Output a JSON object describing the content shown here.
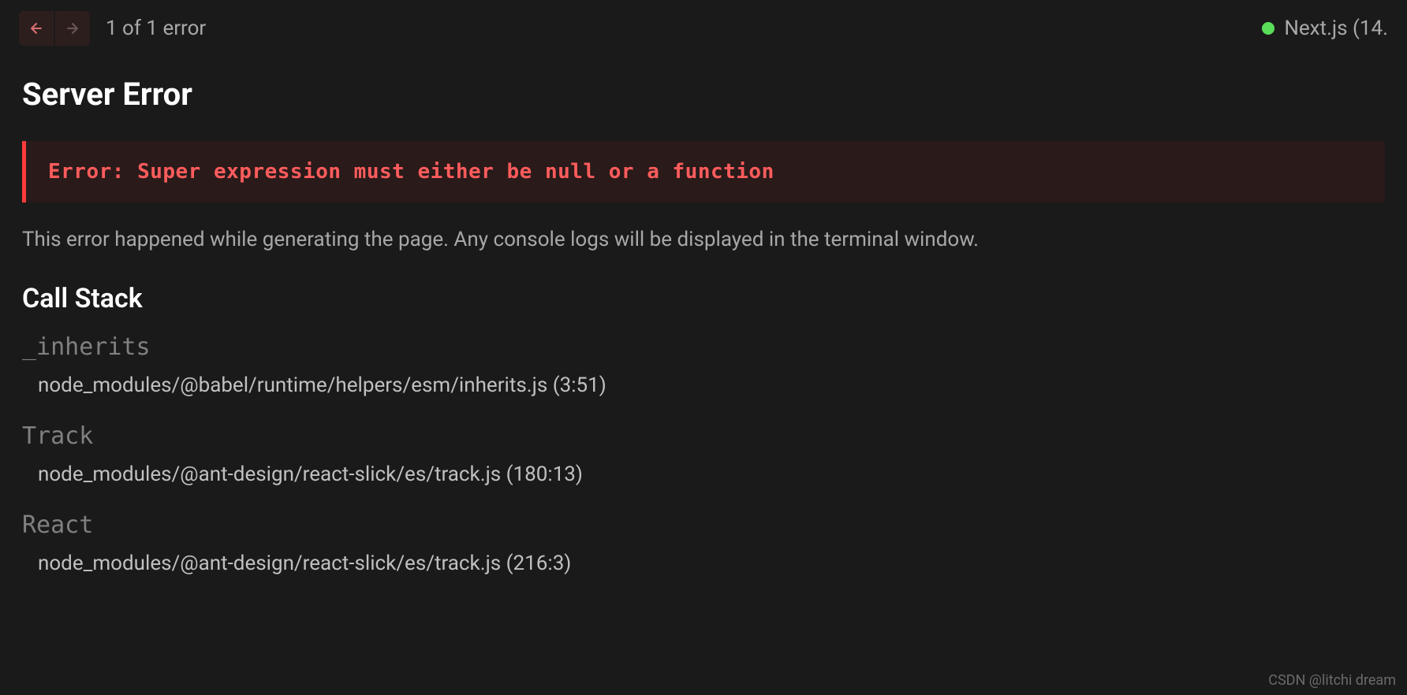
{
  "header": {
    "error_count": "1 of 1 error",
    "version": "Next.js (14."
  },
  "error": {
    "title": "Server Error",
    "message": "Error: Super expression must either be null or a function",
    "description": "This error happened while generating the page. Any console logs will be displayed in the terminal window."
  },
  "callstack": {
    "title": "Call Stack",
    "frames": [
      {
        "fn": "_inherits",
        "location": "node_modules/@babel/runtime/helpers/esm/inherits.js (3:51)"
      },
      {
        "fn": "Track",
        "location": "node_modules/@ant-design/react-slick/es/track.js (180:13)"
      },
      {
        "fn": "React",
        "location": "node_modules/@ant-design/react-slick/es/track.js (216:3)"
      }
    ]
  },
  "watermark": "CSDN @litchi dream"
}
